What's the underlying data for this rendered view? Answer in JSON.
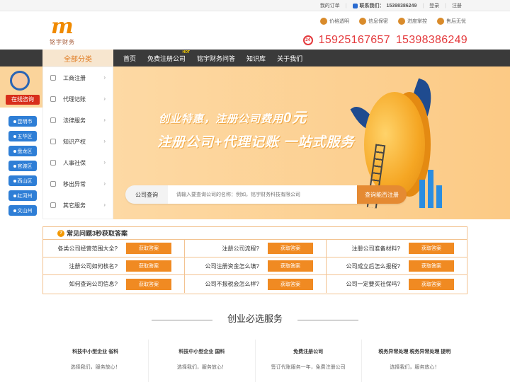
{
  "topbar": {
    "my_orders": "我的订单",
    "contact_label": "联系我们：",
    "contact_phone": "15398386249",
    "login": "登录",
    "register": "注册"
  },
  "header": {
    "logo_sub": "铭宇财务",
    "badges": [
      "价格透明",
      "信息保密",
      "进度掌控",
      "售后无忧"
    ],
    "hotline_badge": "24",
    "hotlines": [
      "15925167657",
      "15398386249"
    ]
  },
  "nav": {
    "all_categories": "全部分类",
    "items": [
      "首页",
      "免费注册公司",
      "铭宇财务问答",
      "知识库",
      "关于我们"
    ],
    "hot_tag": "HOT"
  },
  "categories": [
    "工商注册",
    "代理记账",
    "法律服务",
    "知识产权",
    "人事社保",
    "移出异常",
    "其它服务"
  ],
  "consult": {
    "title": "在线咨询",
    "locations": [
      "昆明市",
      "五华区",
      "盘龙区",
      "官渡区",
      "西山区",
      "红河州",
      "文山州"
    ]
  },
  "hero": {
    "line1_prefix": "创业特惠，注册公司费用",
    "line1_price": "0元",
    "line2": "注册公司+代理记账 一站式服务"
  },
  "search": {
    "label": "公司查询",
    "placeholder": "请输入要查询公司的名称：例如，铭宇财务科技有限公司",
    "button": "查询能否注册"
  },
  "faq": {
    "title": "常见问题3秒获取答案",
    "button_label": "获取答案",
    "questions": [
      "各类公司经营范围大全?",
      "注册公司流程?",
      "注册公司准备材料?",
      "注册公司如何核名?",
      "公司注册资金怎么填?",
      "公司成立后怎么报税?",
      "如何查询公司信息?",
      "公司不报税会怎么样?",
      "公司一定要买社保吗?"
    ]
  },
  "services": {
    "title": "创业必选服务",
    "items": [
      {
        "name": "科技中小型企业 省科",
        "desc": "选择我们，服务放心！"
      },
      {
        "name": "科技中小型企业 国科",
        "desc": "选择我们，服务放心！"
      },
      {
        "name": "免费注册公司",
        "desc": "签订代账服务一年，免费注册公司"
      },
      {
        "name": "税务异常处理 税务异常处理 提明",
        "desc": "选择我们，服务放心！"
      }
    ]
  },
  "colors": {
    "accent": "#f08a22",
    "nav_bg": "#3a3a3a",
    "hotline": "#e4393c",
    "location_blue": "#2e7ed6"
  }
}
